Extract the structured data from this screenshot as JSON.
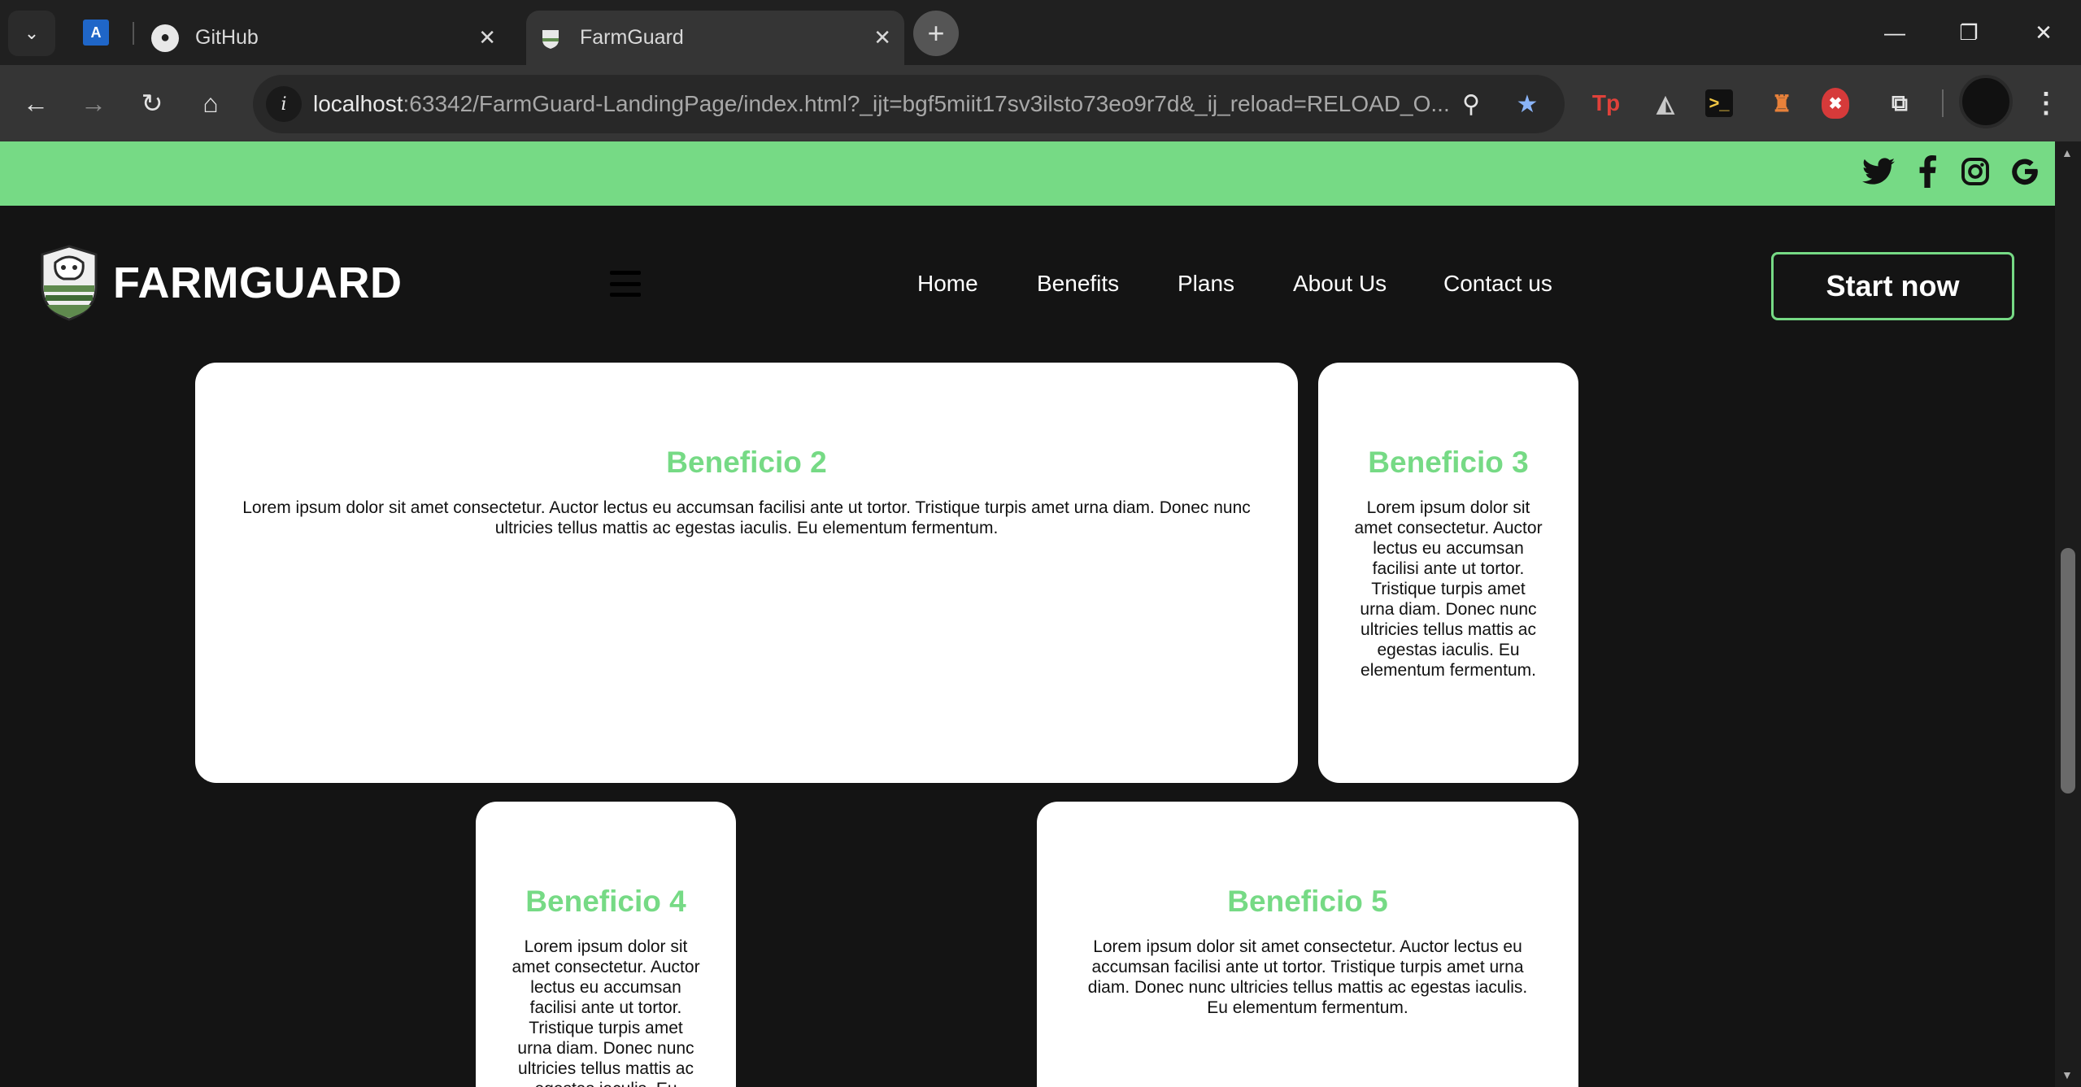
{
  "browser": {
    "tabs": [
      {
        "title": "GitHub",
        "active": false
      },
      {
        "title": "FarmGuard",
        "active": true
      }
    ],
    "url": {
      "host": "localhost",
      "rest": ":63342/FarmGuard-LandingPage/index.html?_ijt=bgf5miit17sv3ilsto73eo9r7d&_ij_reload=RELOAD_O..."
    },
    "icons": {
      "tab_search": "chevron-down-icon",
      "new_tab": "plus-icon",
      "minimize": "minimize-icon",
      "restore": "restore-icon",
      "close": "close-icon",
      "back": "back-arrow-icon",
      "forward": "forward-arrow-icon",
      "reload": "reload-icon",
      "home": "home-icon",
      "zoom": "zoom-icon",
      "bookmark": "star-icon",
      "extensions": "puzzle-icon",
      "menu": "kebab-menu-icon"
    },
    "glyphs": {
      "tab_search": "⌄",
      "close": "✕",
      "new_tab": "+",
      "minimize": "—",
      "restore": "❐",
      "back": "←",
      "forward": "→",
      "reload": "↻",
      "home": "⌂",
      "info": "i",
      "zoom": "⚲",
      "star": "★",
      "puzzle": "⧉",
      "kebab": "⋮",
      "github": "●",
      "pinned": "A",
      "ext1": "Tp",
      "ext2": "◭",
      "ext3": ">_",
      "ext4": "♜",
      "ext5": "✖",
      "scroll_up": "▲",
      "scroll_down": "▼"
    }
  },
  "site": {
    "brand_name": "FARMGUARD",
    "nav_links": [
      "Home",
      "Benefits",
      "Plans",
      "About Us",
      "Contact us"
    ],
    "cta_label": "Start now",
    "social_icons": [
      "twitter-icon",
      "facebook-icon",
      "instagram-icon",
      "google-icon"
    ],
    "social_glyphs": [
      "🐦",
      "f",
      "◎",
      "G"
    ],
    "accent_color": "#76da85",
    "background_color": "#141414"
  },
  "benefits": [
    {
      "title": "Beneficio 2",
      "text": "Lorem ipsum dolor sit amet consectetur. Auctor lectus eu accumsan facilisi ante ut tortor. Tristique turpis amet urna diam. Donec nunc ultricies tellus mattis ac egestas iaculis. Eu elementum fermentum."
    },
    {
      "title": "Beneficio 3",
      "text": "Lorem ipsum dolor sit amet consectetur. Auctor lectus eu accumsan facilisi ante ut tortor. Tristique turpis amet urna diam. Donec nunc ultricies tellus mattis ac egestas iaculis. Eu elementum fermentum."
    },
    {
      "title": "Beneficio 4",
      "text": "Lorem ipsum dolor sit amet consectetur. Auctor lectus eu accumsan facilisi ante ut tortor. Tristique turpis amet urna diam. Donec nunc ultricies tellus mattis ac egestas iaculis. Eu elementum fermentum."
    },
    {
      "title": "Beneficio 5",
      "text": "Lorem ipsum dolor sit amet consectetur. Auctor lectus eu accumsan facilisi ante ut tortor. Tristique turpis amet urna diam. Donec nunc ultricies tellus mattis ac egestas iaculis. Eu elementum fermentum."
    }
  ]
}
